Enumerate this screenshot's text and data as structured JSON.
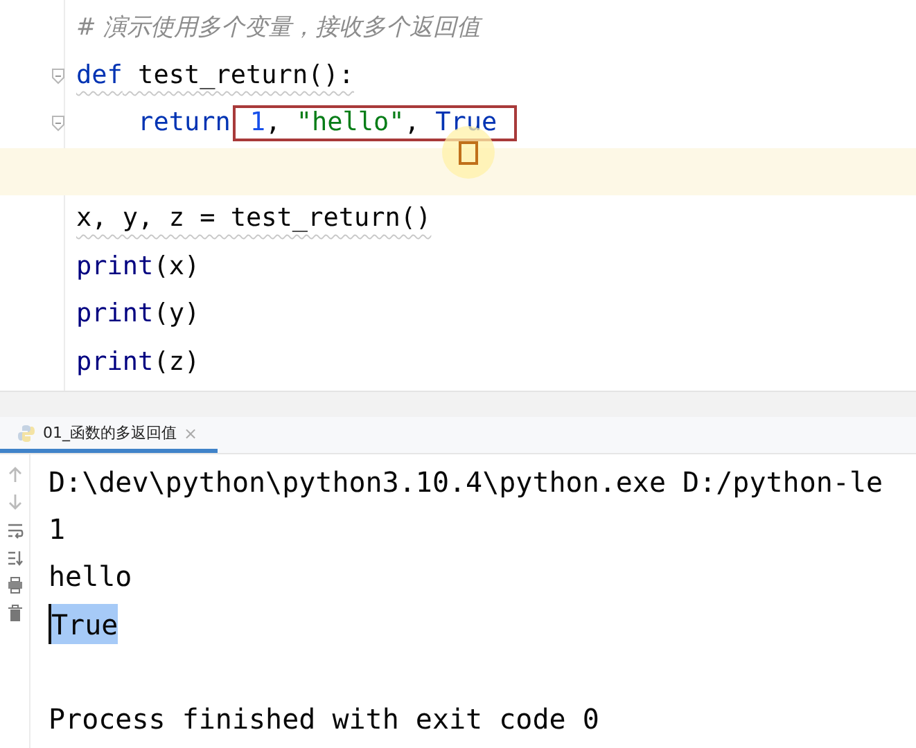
{
  "editor": {
    "lines": [
      {
        "kind": "comment",
        "current": false,
        "warning": false,
        "fold": false,
        "tokens": [
          {
            "text": "# 演示使用多个变量，接收多个返回值",
            "color": "#8c8c8c"
          }
        ]
      },
      {
        "kind": "code",
        "current": false,
        "warning": true,
        "fold": true,
        "tokens": [
          {
            "text": "def",
            "color": "#0033b3"
          },
          {
            "text": " test_return():",
            "color": "#080808"
          }
        ]
      },
      {
        "kind": "code",
        "current": false,
        "warning": false,
        "fold": true,
        "tokens": [
          {
            "text": "    return",
            "color": "#0033b3"
          }
        ],
        "boxed_tokens": [
          {
            "text": "1",
            "color": "#1750eb"
          },
          {
            "text": ", ",
            "color": "#080808"
          },
          {
            "text": "\"hello\"",
            "color": "#067d17"
          },
          {
            "text": ", ",
            "color": "#080808"
          },
          {
            "text": "True",
            "color": "#0033b3"
          }
        ]
      },
      {
        "kind": "empty",
        "current": true,
        "fold": false
      },
      {
        "kind": "code",
        "current": false,
        "warning": true,
        "fold": false,
        "tokens": [
          {
            "text": "x, y, z = test_return()",
            "color": "#080808"
          }
        ]
      },
      {
        "kind": "code",
        "current": false,
        "warning": false,
        "fold": false,
        "tokens": [
          {
            "text": "print",
            "color": "#000080"
          },
          {
            "text": "(x)",
            "color": "#080808"
          }
        ]
      },
      {
        "kind": "code",
        "current": false,
        "warning": false,
        "fold": false,
        "tokens": [
          {
            "text": "print",
            "color": "#000080"
          },
          {
            "text": "(y)",
            "color": "#080808"
          }
        ]
      },
      {
        "kind": "code",
        "current": false,
        "warning": false,
        "fold": false,
        "tokens": [
          {
            "text": "print",
            "color": "#000080"
          },
          {
            "text": "(z)",
            "color": "#080808"
          }
        ]
      }
    ]
  },
  "run_panel": {
    "tab": {
      "label": "01_函数的多返回值",
      "selected": true,
      "close": "×"
    },
    "output": [
      {
        "text": "D:\\dev\\python\\python3.10.4\\python.exe D:/python-le",
        "selected": false
      },
      {
        "text": "1",
        "selected": false
      },
      {
        "text": "hello",
        "selected": false
      },
      {
        "text": "True",
        "selected": true
      },
      {
        "text": "Process finished with exit code 0",
        "selected": false
      }
    ]
  }
}
